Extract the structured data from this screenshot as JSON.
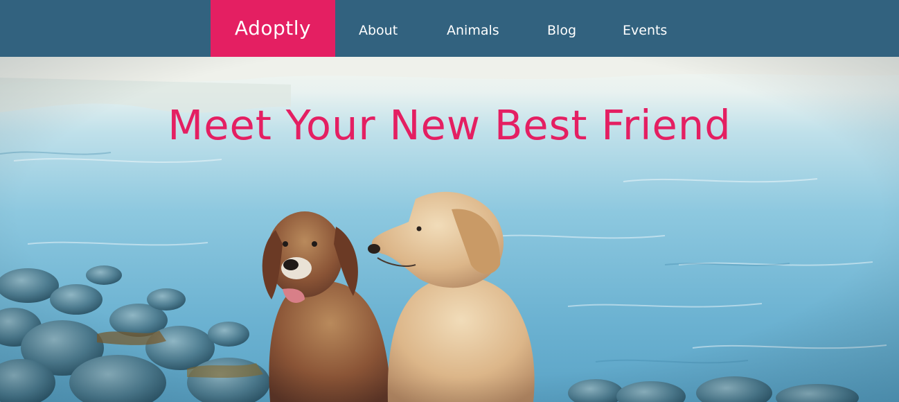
{
  "nav": {
    "brand": "Adoptly",
    "links": [
      "About",
      "Animals",
      "Blog",
      "Events"
    ]
  },
  "hero": {
    "title": "Meet Your New Best Friend"
  },
  "colors": {
    "nav_background": "#32627f",
    "brand_background": "#e41f62",
    "accent_pink": "#e41f62",
    "nav_text": "#ffffff"
  }
}
